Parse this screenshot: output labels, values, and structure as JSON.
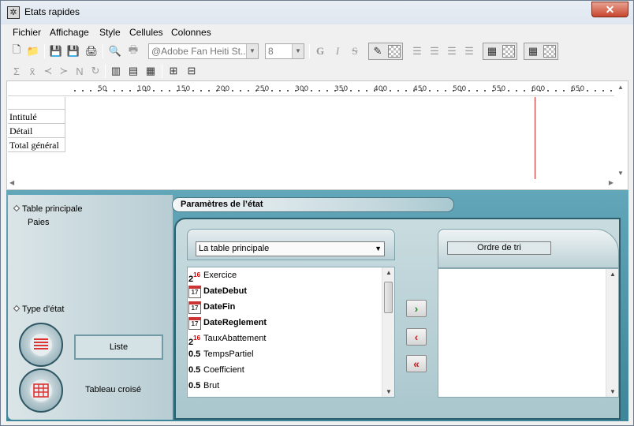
{
  "window": {
    "title": "Etats rapides",
    "close_label": "✕"
  },
  "menu": [
    "Fichier",
    "Affichage",
    "Style",
    "Cellules",
    "Colonnes"
  ],
  "toolbar": {
    "font_value": "@Adobe Fan Heiti St...",
    "size_value": "8",
    "bold": "G",
    "italic": "I",
    "strike": "S"
  },
  "ruler": [
    "50",
    "100",
    "150",
    "200",
    "250",
    "300",
    "350",
    "400",
    "450",
    "500",
    "550",
    "600",
    "650"
  ],
  "rows": [
    "Intitulé",
    "Détail",
    "Total général"
  ],
  "left_panel": {
    "table_label": "Table principale",
    "table_value": "Paies",
    "type_label": "Type d'état",
    "liste_label": "Liste",
    "crosstab_label": "Tableau croisé"
  },
  "params": {
    "title": "Paramètres de l’état",
    "combo_value": "La table principale",
    "sort_title": "Ordre de tri",
    "fields": [
      {
        "label": "Exercice",
        "icon": "integer-icon",
        "bold": false
      },
      {
        "label": "DateDebut",
        "icon": "calendar-icon",
        "bold": true
      },
      {
        "label": "DateFin",
        "icon": "calendar-icon",
        "bold": true
      },
      {
        "label": "DateReglement",
        "icon": "calendar-icon",
        "bold": true
      },
      {
        "label": "TauxAbattement",
        "icon": "integer-icon",
        "bold": false
      },
      {
        "label": "TempsPartiel",
        "icon": "real-icon",
        "bold": false
      },
      {
        "label": "Coefficient",
        "icon": "real-icon",
        "bold": false
      },
      {
        "label": "Brut",
        "icon": "real-icon",
        "bold": false
      }
    ],
    "btn_add": "›",
    "btn_remove": "‹",
    "btn_remove_all": "«"
  }
}
